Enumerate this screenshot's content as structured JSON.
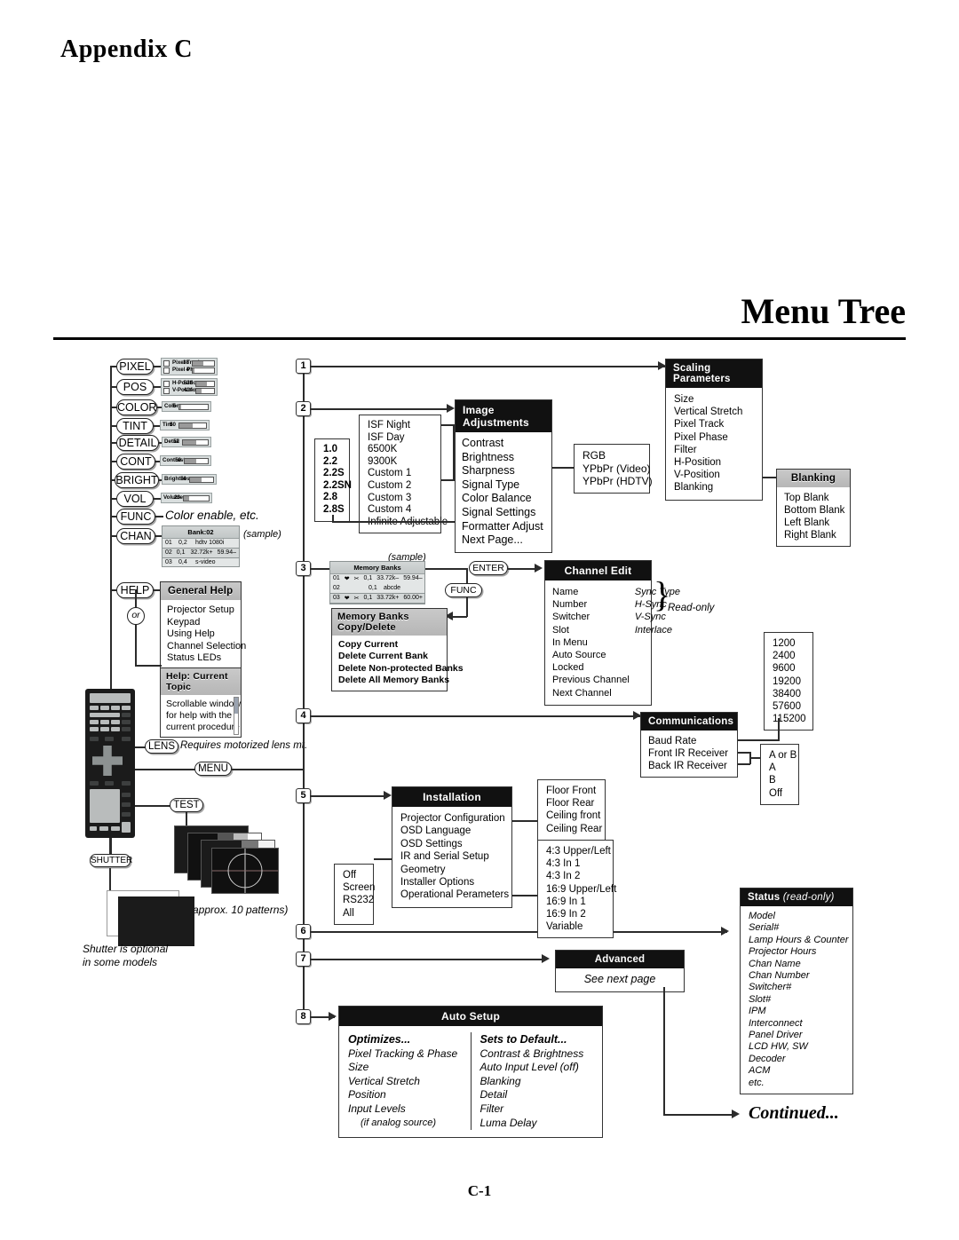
{
  "page": {
    "appendix_title": "Appendix C",
    "section_title": "Menu Tree",
    "page_number": "C-1",
    "continued_label": "Continued..."
  },
  "keypad_buttons": [
    {
      "key": "PIXEL"
    },
    {
      "key": "POS"
    },
    {
      "key": "COLOR"
    },
    {
      "key": "TINT"
    },
    {
      "key": "DETAIL"
    },
    {
      "key": "CONT"
    },
    {
      "key": "BRIGHT"
    },
    {
      "key": "VOL"
    },
    {
      "key": "FUNC"
    },
    {
      "key": "CHAN"
    },
    {
      "key": "HELP"
    }
  ],
  "osd_widgets": {
    "pixel": [
      {
        "label": "Pixel Track",
        "value": "38",
        "fill": 52
      },
      {
        "label": "Pixel Phase",
        "value": "4",
        "fill": 8
      }
    ],
    "pos": [
      {
        "label": "H-Position",
        "value": "538",
        "fill": 58
      },
      {
        "label": "V-Position",
        "value": "414",
        "fill": 30
      }
    ],
    "color": {
      "label": "Color",
      "value": "5",
      "fill": 6
    },
    "tint": {
      "label": "Tint",
      "value": "50",
      "fill": 50
    },
    "detail": {
      "label": "Detail",
      "value": "52",
      "fill": 52
    },
    "cont": {
      "label": "Contrast",
      "value": "50",
      "fill": 50
    },
    "bright": {
      "label": "Brightness",
      "value": "50",
      "fill": 50
    },
    "vol": {
      "label": "Volume",
      "value": "23",
      "fill": 23
    }
  },
  "func_note": "Color enable, etc.",
  "sample_label": "(sample)",
  "bank_table": {
    "header": "Bank:02",
    "rows": [
      {
        "num": "01",
        "slot": "0,2",
        "desc": "hdtv 1080i",
        "extra": ""
      },
      {
        "num": "02",
        "slot": "0,1",
        "desc": "32.72k+",
        "extra": "59.94–"
      },
      {
        "num": "03",
        "slot": "0,4",
        "desc": "s-video",
        "extra": ""
      }
    ]
  },
  "general_help": {
    "title": "General Help",
    "items": [
      "Projector Setup",
      "Keypad",
      "Using Help",
      "Channel Selection",
      "Status LEDs"
    ]
  },
  "or_label": "or",
  "current_topic_help": {
    "title": "Help: Current Topic",
    "lines": [
      "Scrollable window",
      "for help with the",
      "current procedure"
    ]
  },
  "lens": {
    "key": "LENS",
    "note": "Requires motorized lens mt."
  },
  "menu_key": "MENU",
  "test": {
    "key": "TEST",
    "note": "(approx. 10 patterns)"
  },
  "shutter": {
    "key": "SHUTTER",
    "note_line1": "Shutter is optional",
    "note_line2": "in some models"
  },
  "branch_numbers": [
    "1",
    "2",
    "3",
    "4",
    "5",
    "6",
    "7",
    "8"
  ],
  "image_adjustments": {
    "title": "Image Adjustments",
    "items": [
      "Contrast",
      "Brightness",
      "Sharpness",
      "Signal Type",
      "Color Balance",
      "Signal Settings",
      "Formatter Adjust",
      "Next Page..."
    ]
  },
  "color_temp_list": [
    "ISF Night",
    "ISF Day",
    "6500K",
    "9300K",
    "Custom 1",
    "Custom 2",
    "Custom 3",
    "Custom 4",
    "Infinite Adjustable"
  ],
  "gamma_list": [
    "1.0",
    "2.2",
    "2.2S",
    "2.2SN",
    "2.8",
    "2.8S"
  ],
  "signal_type_list": [
    "RGB",
    "YPbPr (Video)",
    "YPbPr (HDTV)"
  ],
  "scaling_parameters": {
    "title": "Scaling Parameters",
    "items": [
      "Size",
      "Vertical Stretch",
      "Pixel Track",
      "Pixel Phase",
      "Filter",
      "H-Position",
      "V-Position",
      "Blanking"
    ]
  },
  "blanking": {
    "title": "Blanking",
    "items": [
      "Top Blank",
      "Bottom Blank",
      "Left Blank",
      "Right Blank"
    ]
  },
  "memory_banks": {
    "title": "Memory Banks",
    "rows": [
      {
        "num": "01",
        "slot": "0,1",
        "freq": "33.72k–",
        "rate": "59.94–"
      },
      {
        "num": "02",
        "slot": "0,1",
        "freq": "abcde",
        "rate": ""
      },
      {
        "num": "03",
        "slot": "0,1",
        "freq": "33.72k+",
        "rate": "60.00+"
      }
    ]
  },
  "enter_key": "ENTER",
  "func_key": "FUNC",
  "memory_banks_copy_delete": {
    "title": "Memory Banks Copy/Delete",
    "items": [
      "Copy Current",
      "Delete Current Bank",
      "Delete Non-protected Banks",
      "Delete All Memory Banks"
    ]
  },
  "channel_edit": {
    "title": "Channel Edit",
    "col_left": [
      "Name",
      "Number",
      "Switcher",
      "Slot",
      "In Menu",
      "Auto Source",
      "Locked",
      "Previous Channel",
      "Next Channel"
    ],
    "col_right": [
      "Sync Type",
      "H-Sync",
      "V-Sync",
      "Interlace"
    ],
    "read_only_label": "Read-only"
  },
  "baud_rates": [
    "1200",
    "2400",
    "9600",
    "19200",
    "38400",
    "57600",
    "115200"
  ],
  "communications": {
    "title": "Communications",
    "items": [
      "Baud Rate",
      "Front IR Receiver",
      "Back IR Receiver"
    ]
  },
  "ir_options": [
    "A or B",
    "A",
    "B",
    "Off"
  ],
  "installation": {
    "title": "Installation",
    "items": [
      "Projector Configuration",
      "OSD Language",
      "OSD Settings",
      "IR and Serial Setup",
      "Geometry",
      "Installer Options",
      "Operational Perameters"
    ]
  },
  "projector_config_list": [
    "Floor Front",
    "Floor Rear",
    "Ceiling front",
    "Ceiling Rear"
  ],
  "serial_setup_list": [
    "Off",
    "Screen",
    "RS232",
    "All"
  ],
  "geometry_list": [
    "4:3 Upper/Left",
    "4:3 In 1",
    "4:3 In 2",
    "16:9 Upper/Left",
    "16:9 In 1",
    "16:9 In 2",
    "Variable"
  ],
  "status": {
    "title": "Status",
    "title_suffix": "(read-only)",
    "items": [
      "Model",
      "Serial#",
      "Lamp Hours & Counter",
      "Projector Hours",
      "Chan Name",
      "Chan Number",
      "Switcher#",
      "Slot#",
      "IPM",
      "Interconnect",
      "Panel Driver",
      "LCD HW, SW",
      "Decoder",
      "ACM",
      "etc."
    ]
  },
  "advanced": {
    "title": "Advanced",
    "note": "See next page"
  },
  "auto_setup": {
    "title": "Auto Setup",
    "left_header": "Optimizes...",
    "left_items": [
      "Pixel Tracking & Phase",
      "Size",
      "Vertical Stretch",
      "Position",
      "Input Levels",
      "(if analog source)"
    ],
    "right_header": "Sets to Default...",
    "right_items": [
      "Contrast & Brightness",
      "Auto Input Level (off)",
      "Blanking",
      "Detail",
      "Filter",
      "Luma Delay"
    ]
  }
}
